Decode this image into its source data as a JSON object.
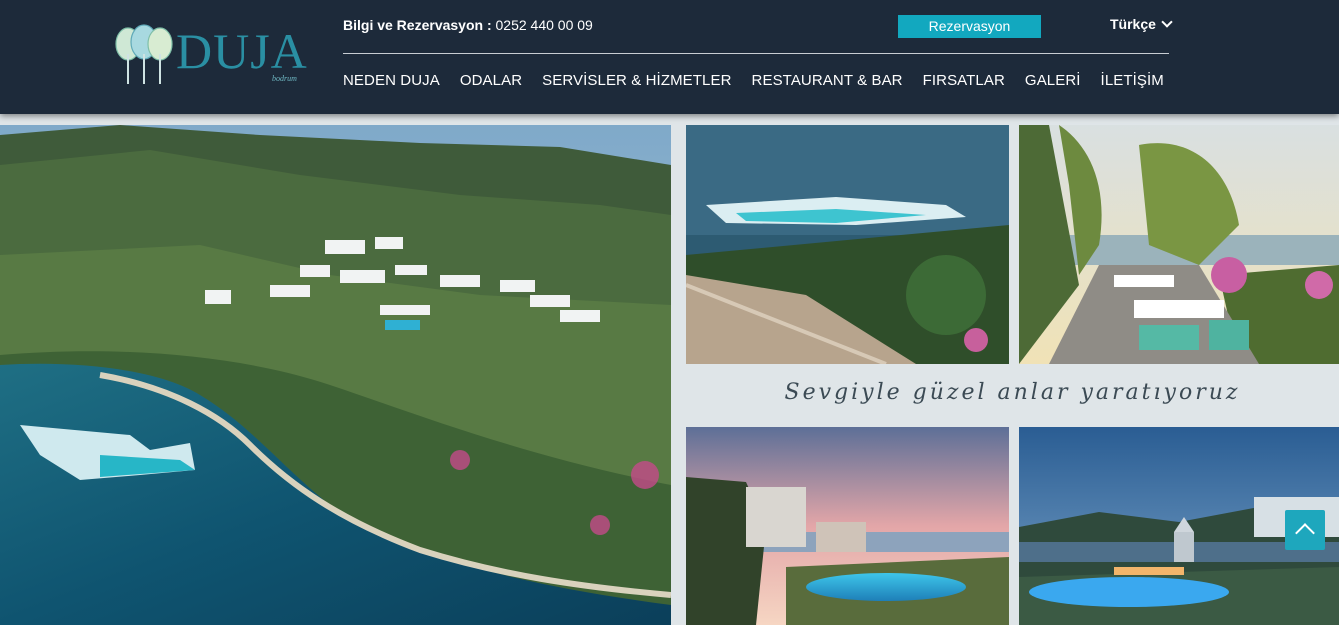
{
  "header": {
    "logo_text": "DUJA",
    "logo_sub": "bodrum",
    "info_label": "Bilgi ve Rezervasyon :",
    "info_phone": "0252 440 00 09",
    "reservation_button": "Rezervasyon",
    "language": "Türkçe"
  },
  "nav": {
    "items": [
      {
        "label": "NEDEN DUJA"
      },
      {
        "label": "ODALAR"
      },
      {
        "label": "SERVİSLER & HİZMETLER"
      },
      {
        "label": "RESTAURANT & BAR"
      },
      {
        "label": "FIRSATLAR"
      },
      {
        "label": "GALERİ"
      },
      {
        "label": "İLETİŞİM"
      }
    ]
  },
  "gallery": {
    "tagline": "Sevgiyle güzel anlar yaratıyoruz"
  },
  "colors": {
    "header_bg": "#1d2a3a",
    "accent": "#12a8bf",
    "page_bg": "#dfe5e8"
  },
  "icons": {
    "language_dropdown": "chevron-down-icon",
    "scroll_top": "arrow-up-icon"
  }
}
